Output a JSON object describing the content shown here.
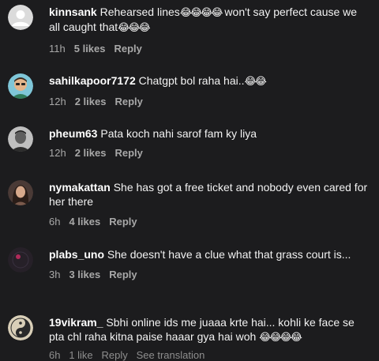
{
  "comments": [
    {
      "username": "kinnsank",
      "text": "Rehearsed lines",
      "emoji1": "😂😂😂😂",
      "text2": " won't say perfect cause we all caught that",
      "emoji2": "😂😂😂",
      "time": "11h",
      "likes": "5 likes",
      "reply": "Reply",
      "avatar": "default-avatar-icon"
    },
    {
      "username": "sahilkapoor7172",
      "text": "Chatgpt bol raha hai..",
      "emoji1": "😂😂",
      "time": "12h",
      "likes": "2 likes",
      "reply": "Reply",
      "avatar": "cartoon-avatar-icon"
    },
    {
      "username": "pheum63",
      "text": "Pata koch nahi sarof fam ky liya",
      "time": "12h",
      "likes": "2 likes",
      "reply": "Reply",
      "avatar": "man-portrait-avatar-icon"
    },
    {
      "username": "nymakattan",
      "text": "She has got a free ticket and nobody even cared for her there",
      "time": "6h",
      "likes": "4 likes",
      "reply": "Reply",
      "avatar": "woman-portrait-avatar-icon"
    },
    {
      "username": "plabs_uno",
      "text": "She doesn't have a clue what that grass court is...",
      "time": "3h",
      "likes": "3 likes",
      "reply": "Reply",
      "avatar": "dark-abstract-avatar-icon"
    },
    {
      "username": "19vikram_",
      "text": "Sbhi online ids me juaaa krte hai... kohli ke face se pta chl raha kitna paise haaar gya hai woh ",
      "emoji1": "😂😂😂😂",
      "time": "6h",
      "likes": "1 like",
      "reply": "Reply",
      "extra": "See translation",
      "avatar": "yin-yang-avatar-icon"
    }
  ],
  "colors": {
    "background": "#1c1c1e",
    "text": "#f2f2f2",
    "meta": "#a8a8a8"
  }
}
